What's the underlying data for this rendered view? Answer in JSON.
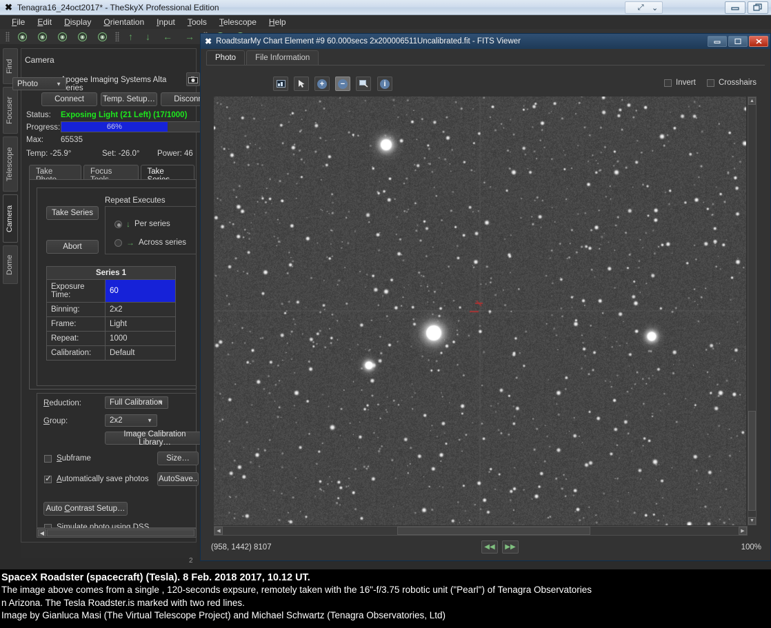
{
  "main_window": {
    "title": "Tenagra16_24oct2017* - TheSkyX Professional Edition",
    "app_icon": "x-logo-icon",
    "menu": [
      {
        "label": "File",
        "accel": "F"
      },
      {
        "label": "Edit",
        "accel": "E"
      },
      {
        "label": "Display",
        "accel": "D"
      },
      {
        "label": "Orientation",
        "accel": "O"
      },
      {
        "label": "Input",
        "accel": "I"
      },
      {
        "label": "Tools",
        "accel": "T"
      },
      {
        "label": "Telescope",
        "accel": "T"
      },
      {
        "label": "Help",
        "accel": "H"
      }
    ],
    "window_buttons": [
      "minimize-button",
      "restore-button"
    ]
  },
  "side_tabs": [
    {
      "label": "Find",
      "selected": false
    },
    {
      "label": "Focuser",
      "selected": false
    },
    {
      "label": "Telescope",
      "selected": false
    },
    {
      "label": "Camera",
      "selected": true
    },
    {
      "label": "Dome",
      "selected": false
    }
  ],
  "camera_panel": {
    "title": "Camera",
    "device": "Apogee Imaging Systems Alta Series",
    "buttons": {
      "connect": "Connect",
      "temp_setup": "Temp. Setup…",
      "disconnect": "Disconn"
    },
    "status_label": "Status:",
    "status_value": "Exposing Light (21 Left) (17/1000)",
    "status_color": "#1de81d",
    "progress_label": "Progress:",
    "progress_value": "66%",
    "progress_percent": 66,
    "progress_color": "#1622d8",
    "max_label": "Max:",
    "max_value": "65535",
    "temp_text": "Temp: -25.9°",
    "set_text": "Set: -26.0°",
    "power_text": "Power: 46",
    "tabs": [
      {
        "label": "Take Photo",
        "selected": false
      },
      {
        "label": "Focus Tools",
        "selected": false
      },
      {
        "label": "Take Series",
        "selected": true
      }
    ],
    "take_series": {
      "group_title": "Repeat Executes",
      "take_series_button": "Take Series",
      "abort_button": "Abort",
      "repeat_options": [
        {
          "label": "Per series",
          "selected": true,
          "icon": "arrow-down-icon"
        },
        {
          "label": "Across series",
          "selected": false,
          "icon": "arrow-right-icon"
        }
      ],
      "table_header": "Series 1",
      "rows": [
        {
          "key": "Exposure Time:",
          "value": "60",
          "highlighted": true
        },
        {
          "key": "Binning:",
          "value": "2x2",
          "highlighted": false
        },
        {
          "key": "Frame:",
          "value": "Light",
          "highlighted": false
        },
        {
          "key": "Repeat:",
          "value": "1000",
          "highlighted": false
        },
        {
          "key": "Calibration:",
          "value": "Default",
          "highlighted": false
        }
      ]
    },
    "options": {
      "reduction_label": "Reduction:",
      "reduction_value": "Full Calibration",
      "group_label": "Group:",
      "group_value": "2x2",
      "calibration_library_button": "Image Calibration Library…",
      "subframe_label": "Subframe",
      "subframe_checked": false,
      "size_button": "Size…",
      "autosave_label": "Automatically save photos",
      "autosave_checked": true,
      "autosave_button": "AutoSave..",
      "auto_contrast_button": "Auto Contrast Setup…",
      "simulate_label": "Simulate photo using DSS",
      "simulate_checked": false
    },
    "footer_number": "2"
  },
  "fits_viewer": {
    "title": "RoadtstarMy Chart Element #9 60.000secs 2x200006511Uncalibrated.fit - FITS Viewer",
    "app_icon": "x-logo-icon",
    "window_buttons": [
      "minimize-button",
      "maximize-button",
      "close-button"
    ],
    "tabs": [
      {
        "label": "Photo",
        "selected": true
      },
      {
        "label": "File Information",
        "selected": false
      }
    ],
    "toolbar": {
      "mode_select": "Photo",
      "icons": [
        {
          "name": "photo-thumbnail-icon",
          "active": false
        },
        {
          "name": "pointer-arrow-icon",
          "active": false
        },
        {
          "name": "zoom-in-icon",
          "active": false
        },
        {
          "name": "zoom-out-icon",
          "active": true
        },
        {
          "name": "region-select-icon",
          "active": false
        },
        {
          "name": "info-icon",
          "active": false
        }
      ],
      "invert_label": "Invert",
      "invert_checked": false,
      "crosshairs_label": "Crosshairs",
      "crosshairs_checked": false
    },
    "status": {
      "coordinates": "(958, 1442) 8107",
      "zoom": "100%",
      "prev_button": "prev-frame-button",
      "next_button": "next-frame-button"
    },
    "image": {
      "description": "grayscale astronomical star field with two red marker lines",
      "marker_color": "#c03030"
    }
  },
  "caption": {
    "title": "SpaceX Roadster (spacecraft) (Tesla). 8 Feb. 2018 2017, 10.12 UT.",
    "lines": [
      "The image above comes from a single , 120-seconds expsure, remotely taken with the 16\"-f/3.75 robotic unit (\"Pearl\") of Tenagra Observatories",
      "n Arizona. The Tesla Roadster.is marked with two red lines.",
      "Image by Gianluca Masi (The Virtual Telescope Project) and Michael Schwartz (Tenagra Observatories, Ltd)"
    ]
  }
}
